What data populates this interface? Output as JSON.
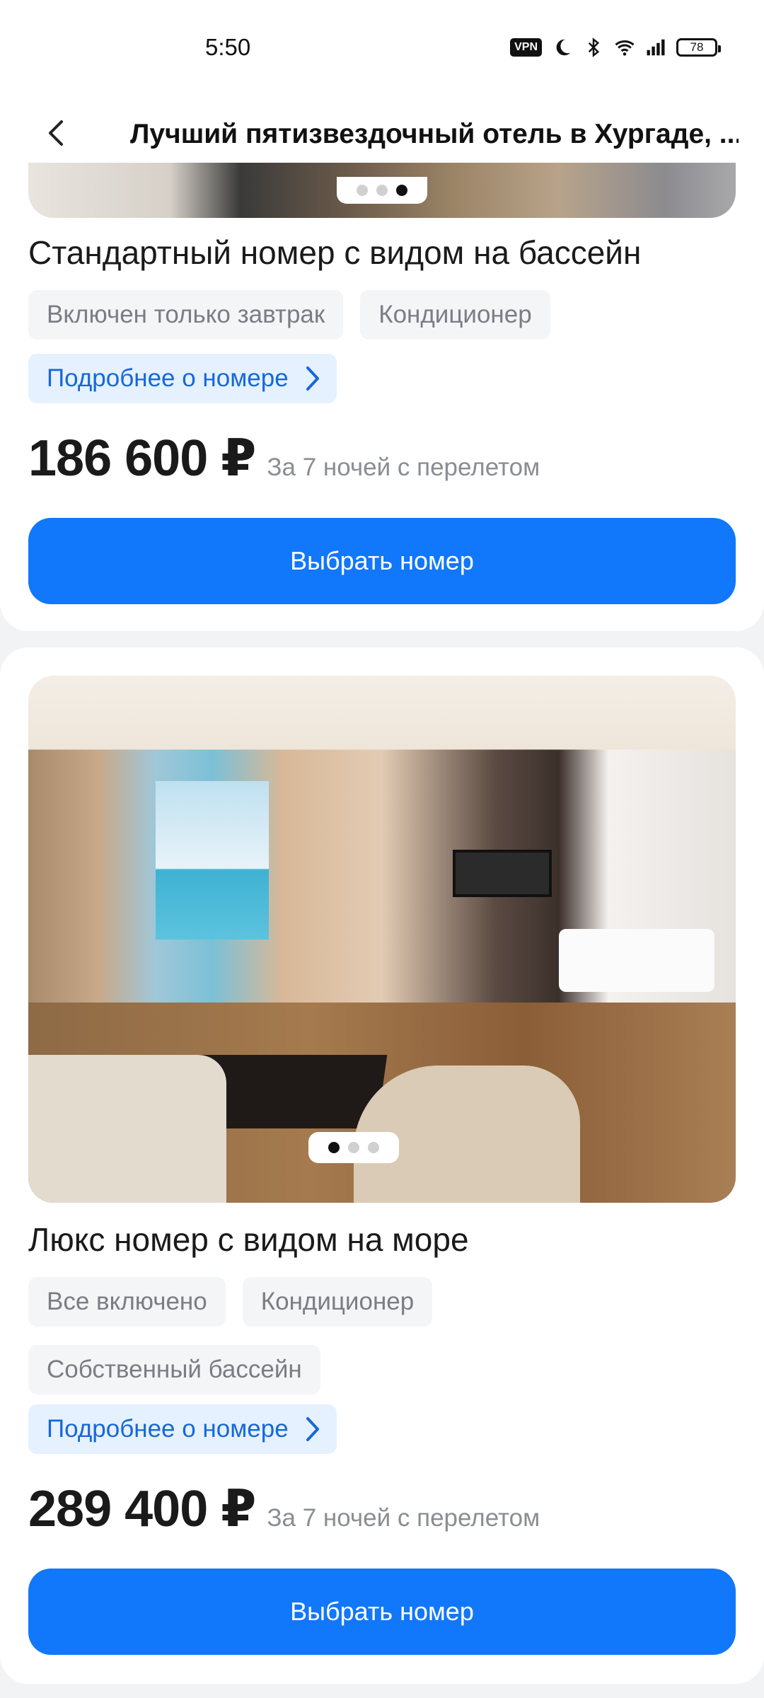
{
  "status_bar": {
    "time": "5:50",
    "vpn_label": "VPN",
    "battery": "78",
    "icons": [
      "vpn-icon",
      "moon-icon",
      "bluetooth-icon",
      "wifi-icon",
      "signal-icon",
      "battery-icon"
    ]
  },
  "header": {
    "back_icon": "chevron-left-icon",
    "title": "Лучший пятизвездочный отель в Хургаде, ..."
  },
  "rooms": [
    {
      "name": "Стандартный номер с видом на бассейн",
      "carousel": {
        "count": 3,
        "active": 3
      },
      "tags": [
        "Включен только завтрак",
        "Кондиционер"
      ],
      "details_label": "Подробнее о номере",
      "price": "186 600 ₽",
      "price_note": "За 7 ночей с перелетом",
      "button_label": "Выбрать номер"
    },
    {
      "name": "Люкс номер с видом на море",
      "carousel": {
        "count": 3,
        "active": 1
      },
      "tags": [
        "Все включено",
        "Кондиционер",
        "Собственный бассейн"
      ],
      "details_label": "Подробнее о номере",
      "price": "289 400 ₽",
      "price_note": "За 7 ночей с перелетом",
      "button_label": "Выбрать номер"
    }
  ],
  "colors": {
    "accent": "#1177FB",
    "link": "#1668D8",
    "link_bg": "#E6F1FF",
    "tag_bg": "#F4F5F7",
    "tag_text": "#7A7D84",
    "page_bg": "#F2F3F5"
  }
}
